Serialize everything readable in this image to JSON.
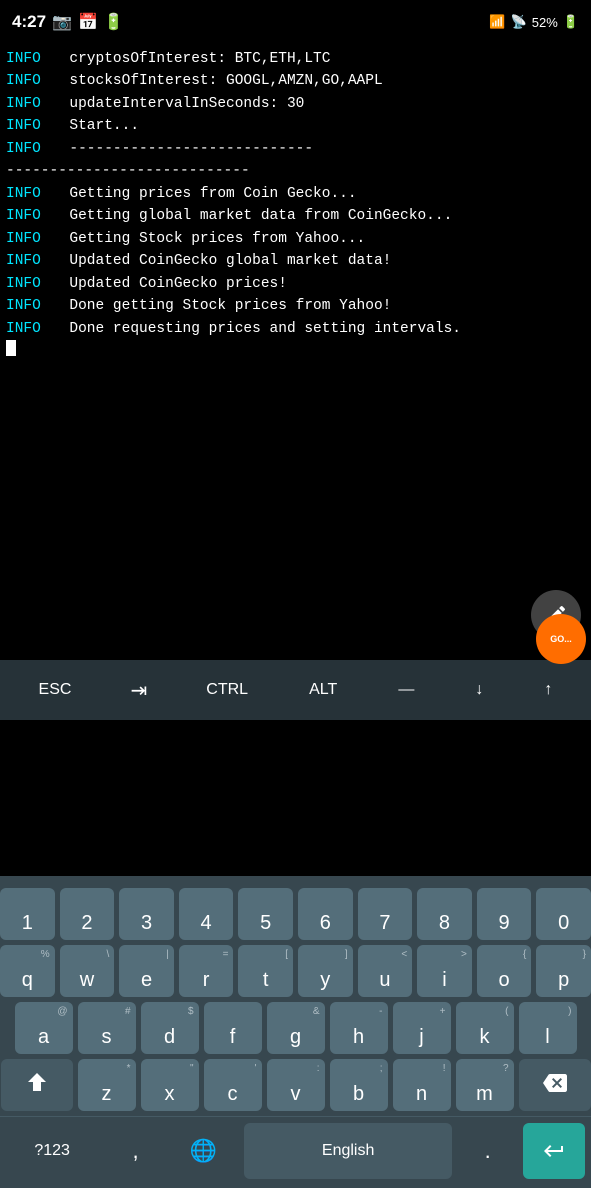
{
  "statusBar": {
    "time": "4:27",
    "battery": "52%",
    "signal": "52"
  },
  "terminal": {
    "lines": [
      {
        "type": "log",
        "level": "INFO",
        "text": "cryptosOfInterest: BTC,ETH,LTC"
      },
      {
        "type": "log",
        "level": "INFO",
        "text": "stocksOfInterest: GOOGL,AMZN,GO,AAPL"
      },
      {
        "type": "log",
        "level": "INFO",
        "text": "updateIntervalInSeconds: 30"
      },
      {
        "type": "log",
        "level": "INFO",
        "text": "Start..."
      },
      {
        "type": "log",
        "level": "INFO",
        "text": "----------------------------"
      },
      {
        "type": "divider",
        "text": "----------------------------"
      },
      {
        "type": "log",
        "level": "INFO",
        "text": "Getting prices from Coin Gecko..."
      },
      {
        "type": "log",
        "level": "INFO",
        "text": "Getting global market data from CoinGecko..."
      },
      {
        "type": "log",
        "level": "INFO",
        "text": "Getting Stock prices from Yahoo..."
      },
      {
        "type": "log",
        "level": "INFO",
        "text": "Updated CoinGecko global market data!"
      },
      {
        "type": "log",
        "level": "INFO",
        "text": "Updated CoinGecko prices!"
      },
      {
        "type": "log",
        "level": "INFO",
        "text": "Done getting Stock prices from Yahoo!"
      },
      {
        "type": "log",
        "level": "INFO",
        "text": "Done requesting prices and setting intervals."
      }
    ]
  },
  "specialKeys": {
    "esc": "ESC",
    "tab": "⇥",
    "ctrl": "CTRL",
    "alt": "ALT",
    "dash": "—",
    "down": "↓",
    "up": "↑"
  },
  "numberRow": [
    "1",
    "2",
    "3",
    "4",
    "5",
    "6",
    "7",
    "8",
    "9",
    "0"
  ],
  "rows": [
    {
      "keys": [
        {
          "label": "q",
          "super": "%"
        },
        {
          "label": "w",
          "super": "\\"
        },
        {
          "label": "e",
          "super": "|"
        },
        {
          "label": "r",
          "super": "="
        },
        {
          "label": "t",
          "super": "["
        },
        {
          "label": "y",
          "super": "]"
        },
        {
          "label": "u",
          "super": "<"
        },
        {
          "label": "i",
          "super": ">"
        },
        {
          "label": "o",
          "super": "{"
        },
        {
          "label": "p",
          "super": "}"
        }
      ]
    },
    {
      "keys": [
        {
          "label": "a",
          "super": "@"
        },
        {
          "label": "s",
          "super": "#"
        },
        {
          "label": "d",
          "super": "$"
        },
        {
          "label": "f",
          "super": ""
        },
        {
          "label": "g",
          "super": "&"
        },
        {
          "label": "h",
          "super": "-"
        },
        {
          "label": "j",
          "super": "+"
        },
        {
          "label": "k",
          "super": "("
        },
        {
          "label": "l",
          "super": ")"
        }
      ]
    },
    {
      "keys": [
        {
          "label": "z",
          "super": "*"
        },
        {
          "label": "x",
          "super": "\""
        },
        {
          "label": "c",
          "super": "'"
        },
        {
          "label": "v",
          "super": ":"
        },
        {
          "label": "b",
          "super": ";"
        },
        {
          "label": "n",
          "super": "!"
        },
        {
          "label": "m",
          "super": "?"
        }
      ]
    }
  ],
  "bottomBar": {
    "symbols": "?123",
    "comma": ",",
    "globe": "🌐",
    "english": "English",
    "period": ".",
    "enter": "↵"
  }
}
